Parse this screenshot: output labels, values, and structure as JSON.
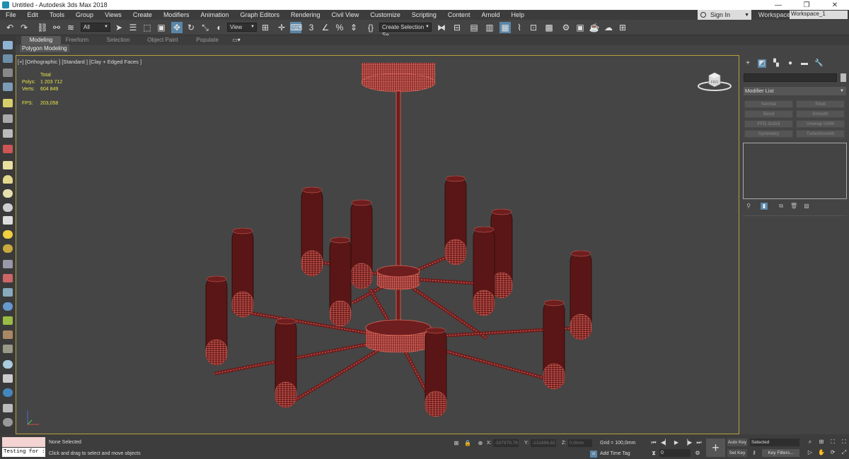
{
  "window": {
    "title": "Untitled - Autodesk 3ds Max 2018",
    "minimize": "—",
    "maximize": "❐",
    "close": "✕"
  },
  "menu": [
    "File",
    "Edit",
    "Tools",
    "Group",
    "Views",
    "Create",
    "Modifiers",
    "Animation",
    "Graph Editors",
    "Rendering",
    "Civil View",
    "Customize",
    "Scripting",
    "Content",
    "Arnold",
    "Help"
  ],
  "account": {
    "sign_in": "Sign In",
    "workspaces_label": "Workspaces:",
    "workspace": "Workspace_1"
  },
  "toolbar": {
    "filter": "All",
    "ref_coord": "View",
    "selection_set": "Create Selection Se"
  },
  "ribbon": {
    "tabs": [
      "Modeling",
      "Freeform",
      "Selection",
      "Object Paint",
      "Populate"
    ],
    "active": "Modeling",
    "subtitle": "Polygon Modeling"
  },
  "viewport": {
    "label": "[+] [Orthographic ] [Standard ] [Clay + Edged Faces ]",
    "stats": {
      "total_label": "Total",
      "polys_label": "Polys:",
      "polys": "1 203 712",
      "verts_label": "Verts:",
      "verts": "604 849",
      "fps_label": "FPS:",
      "fps": "203,058"
    },
    "viewcube_label": "FRO"
  },
  "command_panel": {
    "modifier_list": "Modifier List",
    "modifiers": [
      "Normal",
      "Shell",
      "Bend",
      "Smooth",
      "FFD 3x3x3",
      "Unwrap UVW",
      "Symmetry",
      "TurboSmooth"
    ]
  },
  "status": {
    "maxscript_text": "Testing for :",
    "selection": "None Selected",
    "prompt": "Click and drag to select and move objects",
    "x_label": "X:",
    "x": "-337979,76",
    "y_label": "Y:",
    "y": "-131656,82",
    "z_label": "Z:",
    "z": "0,0mm",
    "grid": "Grid = 100,0mm",
    "add_time_tag": "Add Time Tag",
    "frame": "0",
    "auto_key": "Auto Key",
    "set_key": "Set Key",
    "selected": "Selected",
    "key_filters": "Key Filters..."
  },
  "colors": {
    "wire": "#e06a5e",
    "body": "#5a1616",
    "viewport_bg": "#454545",
    "active_border": "#b8a03a",
    "stats_text": "#e8e44a"
  }
}
